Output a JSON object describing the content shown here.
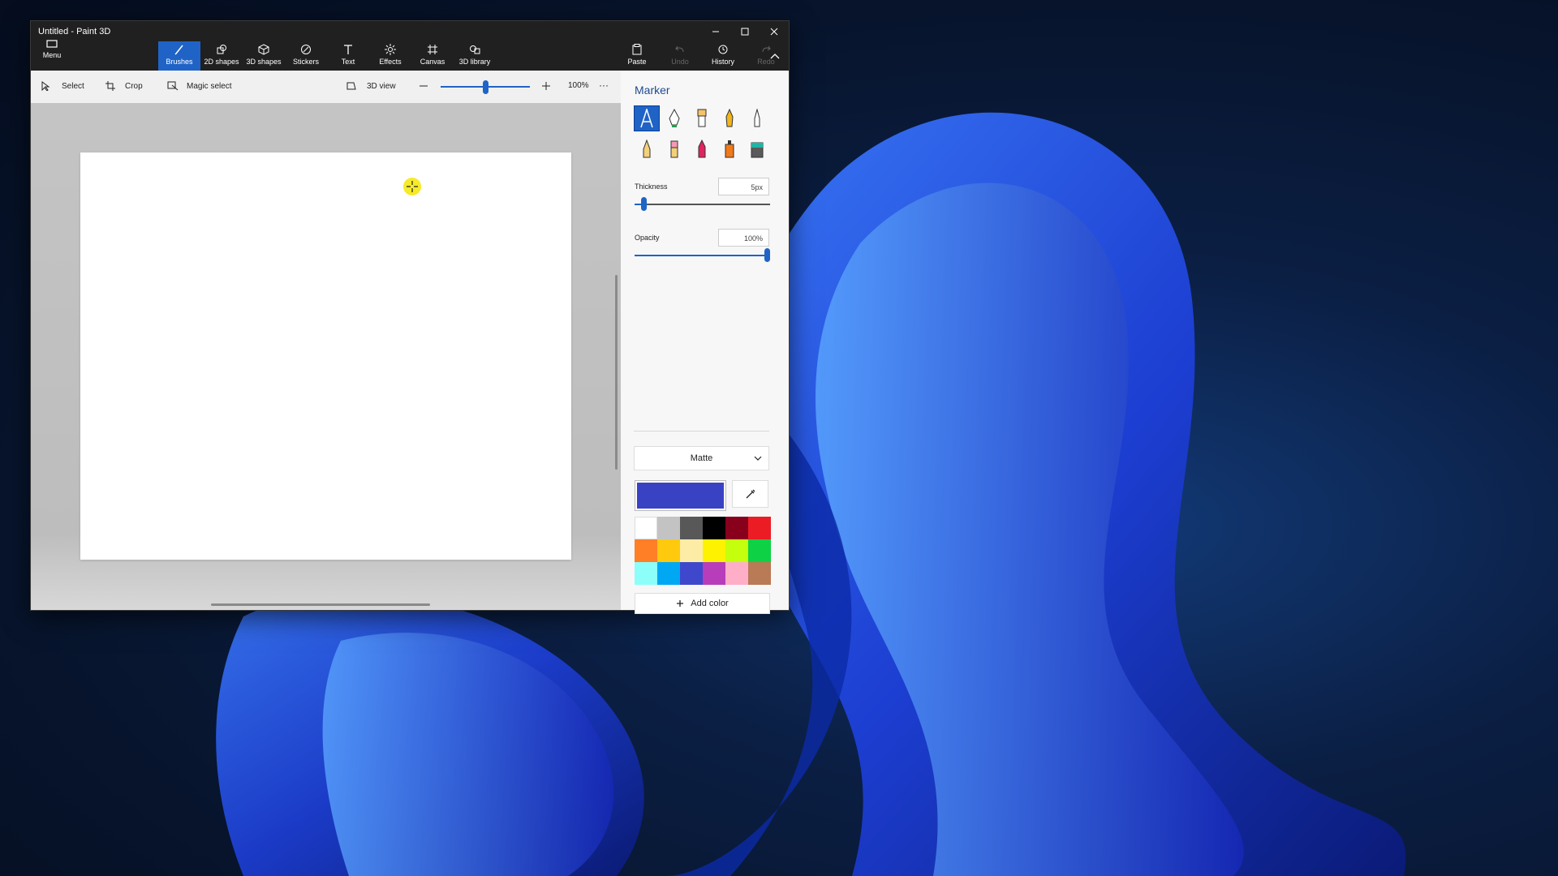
{
  "window": {
    "title": "Untitled - Paint 3D",
    "minimize_icon": "minimize-icon",
    "maximize_icon": "maximize-icon",
    "close_icon": "close-icon"
  },
  "ribbon": {
    "menu_label": "Menu",
    "tabs": [
      {
        "label": "Brushes",
        "icon": "brush-icon",
        "active": true
      },
      {
        "label": "2D shapes",
        "icon": "2d-shapes-icon"
      },
      {
        "label": "3D shapes",
        "icon": "3d-shapes-icon"
      },
      {
        "label": "Stickers",
        "icon": "stickers-icon"
      },
      {
        "label": "Text",
        "icon": "text-icon"
      },
      {
        "label": "Effects",
        "icon": "effects-icon"
      },
      {
        "label": "Canvas",
        "icon": "canvas-icon"
      },
      {
        "label": "3D library",
        "icon": "3d-library-icon"
      }
    ],
    "actions": [
      {
        "label": "Paste",
        "icon": "paste-icon",
        "enabled": true
      },
      {
        "label": "Undo",
        "icon": "undo-icon",
        "enabled": false
      },
      {
        "label": "History",
        "icon": "history-icon",
        "enabled": true
      },
      {
        "label": "Redo",
        "icon": "redo-icon",
        "enabled": false
      }
    ]
  },
  "toolbar": {
    "select_label": "Select",
    "crop_label": "Crop",
    "magic_select_label": "Magic select",
    "view3d_label": "3D view",
    "zoom_value": "100%",
    "zoom_level": 0.5,
    "more_label": "···"
  },
  "panel": {
    "title": "Marker",
    "thickness_label": "Thickness",
    "thickness_value": "5px",
    "thickness_level": 0.05,
    "opacity_label": "Opacity",
    "opacity_value": "100%",
    "opacity_level": 1.0,
    "finish_value": "Matte",
    "selected_color": "#3a42c4",
    "add_color_label": "Add color",
    "palette": [
      "#ffffff",
      "#c3c3c3",
      "#585858",
      "#000000",
      "#88001b",
      "#ec1c24",
      "#ff7f27",
      "#ffc90e",
      "#fdeca6",
      "#fff200",
      "#c4ff0e",
      "#0ed145",
      "#8cfffb",
      "#00a8f3",
      "#3f48cc",
      "#b83dba",
      "#ffaec8",
      "#b97a56"
    ]
  }
}
